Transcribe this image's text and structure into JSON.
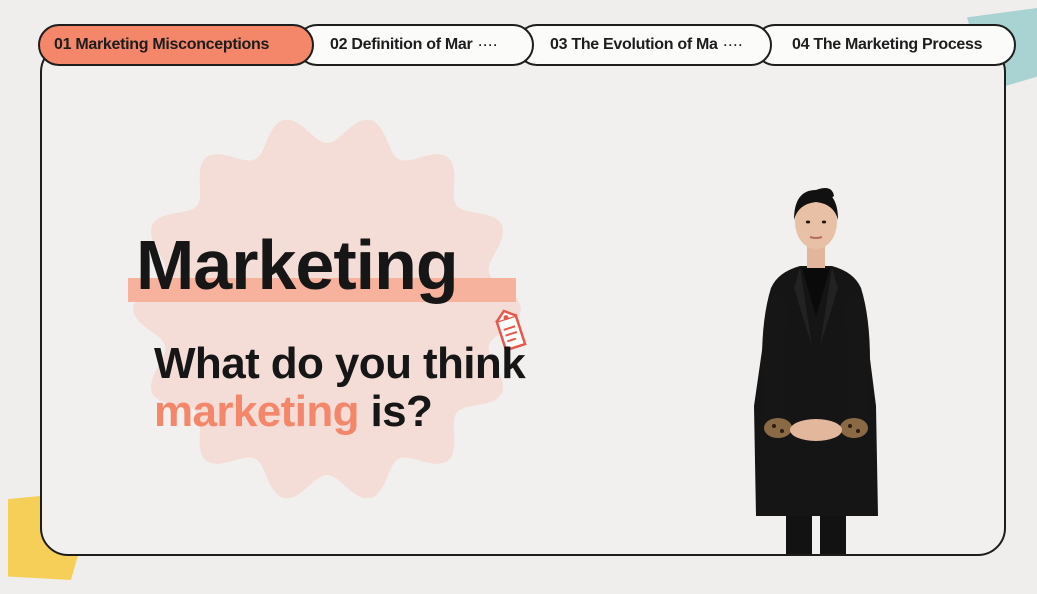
{
  "tabs": [
    {
      "label": "01 Marketing Misconceptions",
      "active": true,
      "more": ""
    },
    {
      "label": "02 Definition of  Mar",
      "active": false,
      "more": "····"
    },
    {
      "label": "03 The Evolution of Ma",
      "active": false,
      "more": "····"
    },
    {
      "label": "04 The Marketing Process",
      "active": false,
      "more": ""
    }
  ],
  "slide": {
    "title": "Marketing",
    "question_line1": "What do you think",
    "question_accent": "marketing",
    "question_end": " is?"
  },
  "colors": {
    "accent": "#f4866a",
    "highlight": "#f7b29d",
    "blob": "#f4ddd6",
    "teal_deco": "#a9d3d2",
    "yellow_deco": "#f5cf57",
    "outline": "#1d1d1d"
  },
  "icons": [
    "price-tag-icon"
  ]
}
